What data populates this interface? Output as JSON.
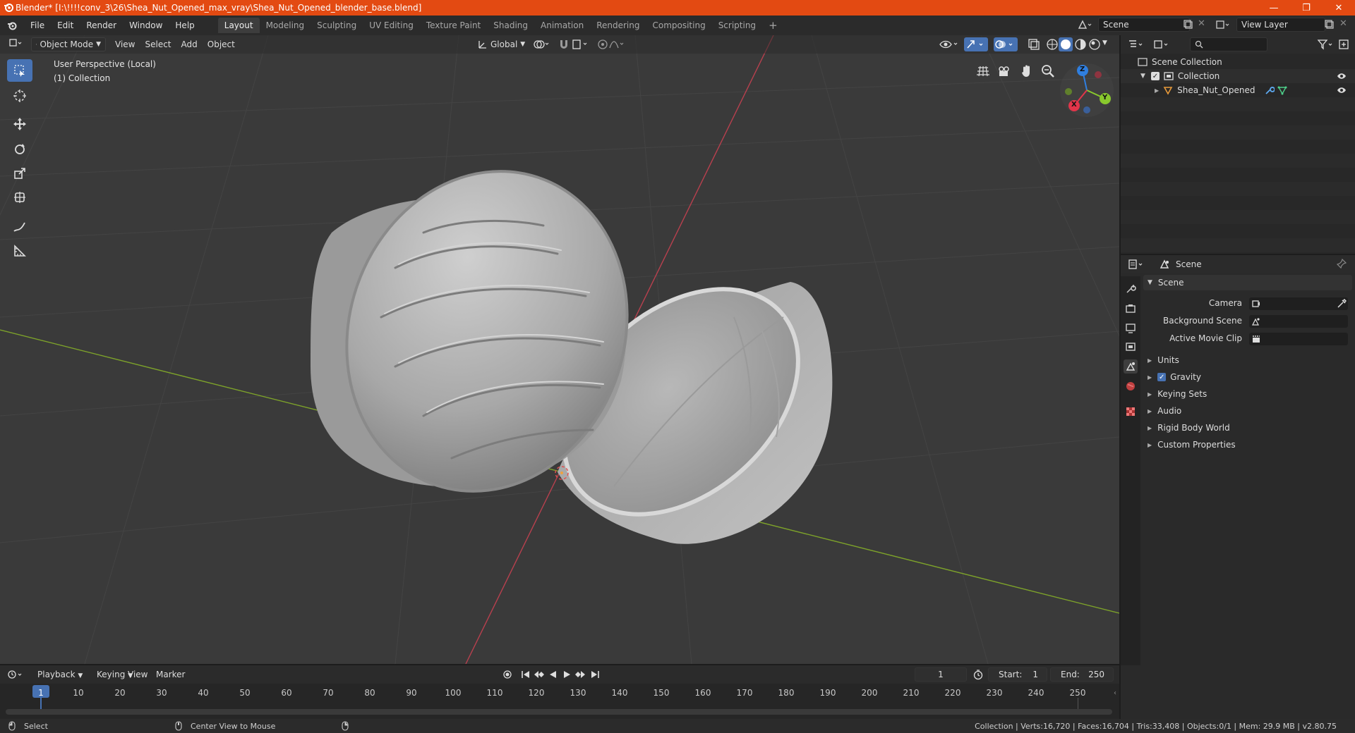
{
  "window": {
    "title": "Blender* [I:\\!!!!conv_3\\26\\Shea_Nut_Opened_max_vray\\Shea_Nut_Opened_blender_base.blend]",
    "minimize": "—",
    "maximize": "❐",
    "close": "✕"
  },
  "menu": [
    "File",
    "Edit",
    "Render",
    "Window",
    "Help"
  ],
  "workspaces": [
    "Layout",
    "Modeling",
    "Sculpting",
    "UV Editing",
    "Texture Paint",
    "Shading",
    "Animation",
    "Rendering",
    "Compositing",
    "Scripting"
  ],
  "workspace_add": "+",
  "scene_name": "Scene",
  "view_layer": "View Layer",
  "viewport": {
    "mode": "Object Mode",
    "menus": [
      "View",
      "Select",
      "Add",
      "Object"
    ],
    "transform_orientation": "Global",
    "perspective": "User Perspective (Local)",
    "collection": "(1) Collection",
    "gizmo_axes": {
      "x": "X",
      "y": "Y",
      "z": "Z"
    }
  },
  "outliner": {
    "root": "Scene Collection",
    "collection": "Collection",
    "object": "Shea_Nut_Opened"
  },
  "properties": {
    "header": "Scene",
    "panel": "Scene",
    "fields": [
      {
        "label": "Camera"
      },
      {
        "label": "Background Scene"
      },
      {
        "label": "Active Movie Clip"
      }
    ],
    "sections": [
      "Units",
      "Gravity",
      "Keying Sets",
      "Audio",
      "Rigid Body World",
      "Custom Properties"
    ]
  },
  "timeline": {
    "menus": [
      "Playback",
      "Keying",
      "View",
      "Marker"
    ],
    "current_frame": "1",
    "start_label": "Start:",
    "start": "1",
    "end_label": "End:",
    "end": "250",
    "ticks": [
      "1",
      "10",
      "20",
      "30",
      "40",
      "50",
      "60",
      "70",
      "80",
      "90",
      "100",
      "110",
      "120",
      "130",
      "140",
      "150",
      "160",
      "170",
      "180",
      "190",
      "200",
      "210",
      "220",
      "230",
      "240",
      "250"
    ]
  },
  "statusbar": {
    "left_action": "Select",
    "mid_action": "Center View to Mouse",
    "stats": "Collection | Verts:16,720 | Faces:16,704 | Tris:33,408 | Objects:0/1 | Mem: 29.9 MB | v2.80.75"
  },
  "colors": {
    "titlebar": "#e34a12",
    "accent": "#4772b3",
    "x_axis": "#e2354a",
    "y_axis": "#89c92d",
    "z_axis": "#2f7fe0"
  }
}
